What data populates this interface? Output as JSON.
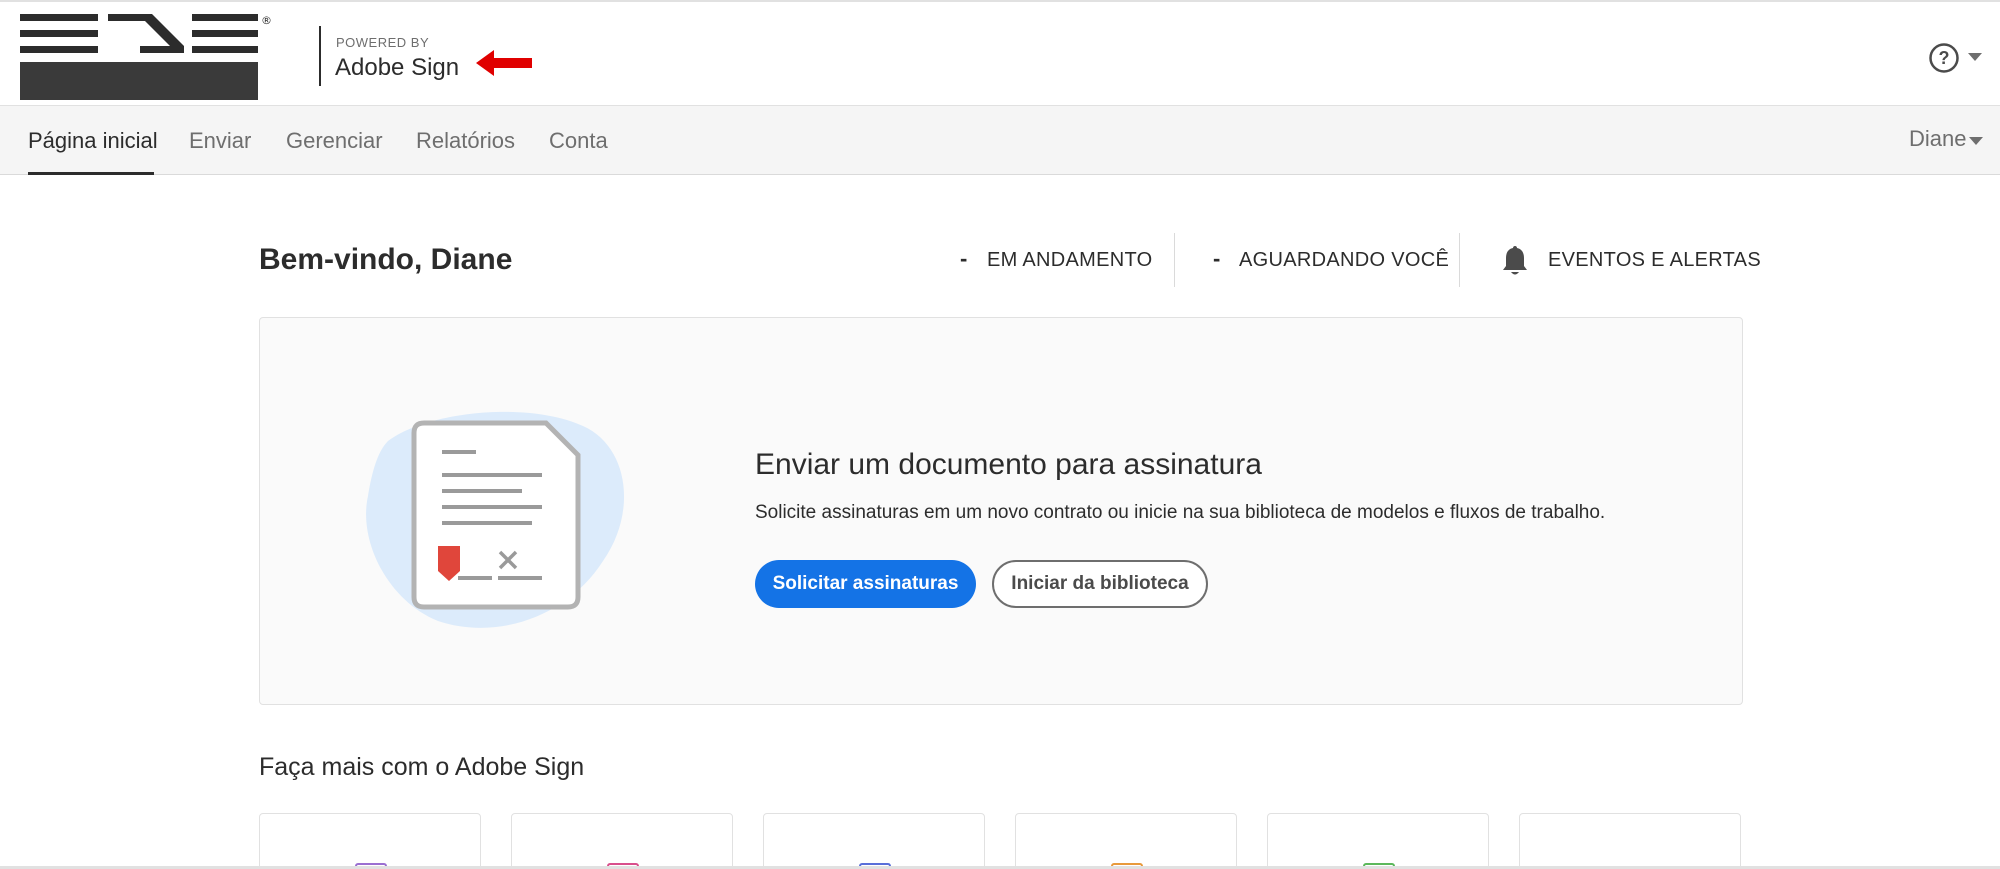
{
  "header": {
    "powered_by": "POWERED BY",
    "brand": "Adobe Sign",
    "logo_icon": "ens-logo",
    "help_icon": "help-circle-icon"
  },
  "nav": {
    "tabs": [
      {
        "label": "Página inicial",
        "active": true
      },
      {
        "label": "Enviar",
        "active": false
      },
      {
        "label": "Gerenciar",
        "active": false
      },
      {
        "label": "Relatórios",
        "active": false
      },
      {
        "label": "Conta",
        "active": false
      }
    ],
    "user": "Diane"
  },
  "welcome": {
    "title": "Bem-vindo, Diane",
    "status": [
      {
        "count": "-",
        "label": "EM ANDAMENTO"
      },
      {
        "count": "-",
        "label": "AGUARDANDO VOCÊ"
      },
      {
        "label": "EVENTOS E ALERTAS",
        "icon": "bell-icon"
      }
    ]
  },
  "hero": {
    "title": "Enviar um documento para assinatura",
    "description": "Solicite assinaturas em um novo contrato ou inicie na sua biblioteca de modelos e fluxos de trabalho.",
    "primary_button": "Solicitar assinaturas",
    "secondary_button": "Iniciar da biblioteca"
  },
  "more": {
    "title": "Faça mais com o Adobe Sign",
    "card_icon_colors": [
      "#9b6fd1",
      "#d94f8c",
      "#5a6fd9",
      "#e89a3c",
      "#5cb85c",
      "#ffffff"
    ]
  },
  "colors": {
    "accent": "#1473e6",
    "arrow": "#e00000",
    "signature_flag": "#e0463b"
  }
}
